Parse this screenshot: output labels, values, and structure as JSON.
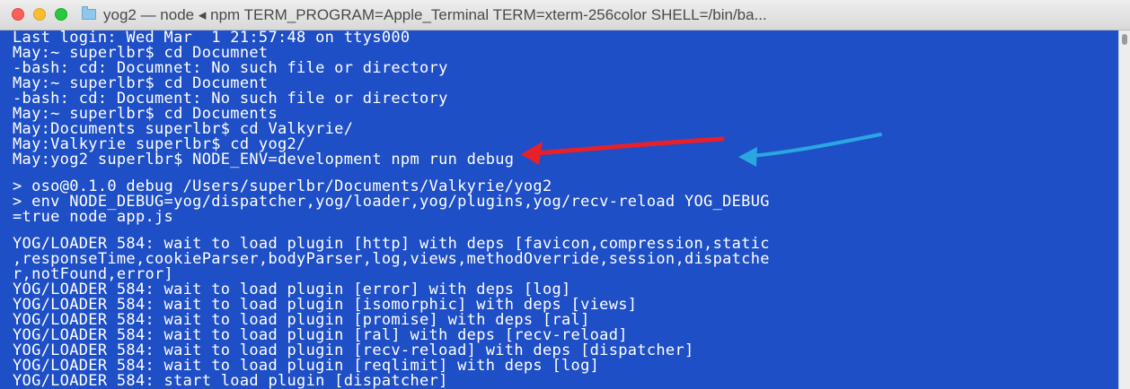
{
  "window": {
    "title": "yog2 — node ◂ npm TERM_PROGRAM=Apple_Terminal TERM=xterm-256color SHELL=/bin/ba...",
    "folder_icon": "folder-icon"
  },
  "terminal": {
    "background_color": "#1f4fc7",
    "text_color": "#ffffff",
    "lines": [
      "Last login: Wed Mar  1 21:57:48 on ttys000",
      "May:~ superlbr$ cd Documnet",
      "-bash: cd: Documnet: No such file or directory",
      "May:~ superlbr$ cd Document",
      "-bash: cd: Document: No such file or directory",
      "May:~ superlbr$ cd Documents",
      "May:Documents superlbr$ cd Valkyrie/",
      "May:Valkyrie superlbr$ cd yog2/",
      "May:yog2 superlbr$ NODE_ENV=development npm run debug",
      "",
      "> oso@0.1.0 debug /Users/superlbr/Documents/Valkyrie/yog2",
      "> env NODE_DEBUG=yog/dispatcher,yog/loader,yog/plugins,yog/recv-reload YOG_DEBUG",
      "=true node app.js",
      "",
      "YOG/LOADER 584: wait to load plugin [http] with deps [favicon,compression,static",
      ",responseTime,cookieParser,bodyParser,log,views,methodOverride,session,dispatche",
      "r,notFound,error]",
      "YOG/LOADER 584: wait to load plugin [error] with deps [log]",
      "YOG/LOADER 584: wait to load plugin [isomorphic] with deps [views]",
      "YOG/LOADER 584: wait to load plugin [promise] with deps [ral]",
      "YOG/LOADER 584: wait to load plugin [ral] with deps [recv-reload]",
      "YOG/LOADER 584: wait to load plugin [recv-reload] with deps [dispatcher]",
      "YOG/LOADER 584: wait to load plugin [reqlimit] with deps [log]",
      "YOG/LOADER 584: start load plugin [dispatcher]"
    ]
  },
  "annotations": {
    "red_arrow_color": "#e8202a",
    "blue_arrow_color": "#2aa7e0"
  }
}
